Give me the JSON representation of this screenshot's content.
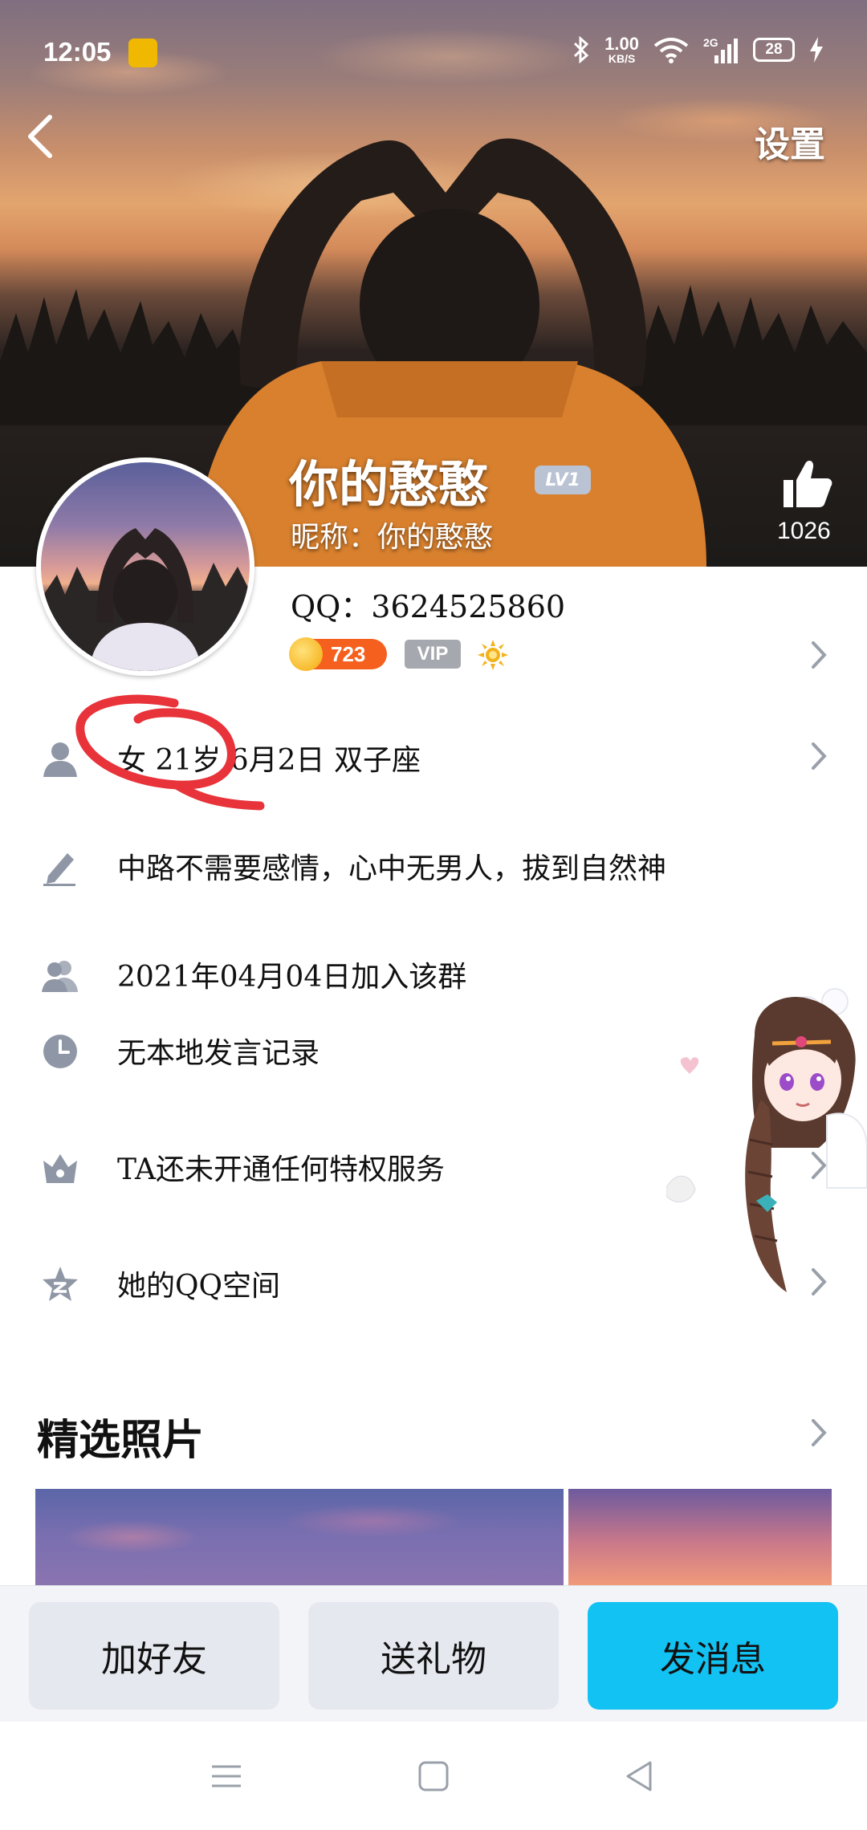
{
  "status_bar": {
    "time": "12:05",
    "speed_value": "1.00",
    "speed_unit": "KB/S",
    "network": "2G",
    "battery": "28"
  },
  "header": {
    "settings_label": "设置"
  },
  "profile": {
    "name": "你的憨憨",
    "level_badge": "LV1",
    "nickname": "昵称：你的憨憨",
    "likes": "1026",
    "qq": "QQ：3624525860",
    "coins": "723",
    "vip_label": "VIP"
  },
  "info_rows": {
    "basic": "女  21岁  6月2日  双子座",
    "signature": "中路不需要感情，心中无男人，拔到自然神",
    "joined": "2021年04月04日加入该群",
    "speech": "无本地发言记录",
    "privilege": "TA还未开通任何特权服务",
    "qzone": "她的QQ空间"
  },
  "featured": {
    "title": "精选照片"
  },
  "actions": {
    "add_friend": "加好友",
    "send_gift": "送礼物",
    "send_message": "发消息"
  },
  "colors": {
    "primary": "#12c2f2",
    "row_icon": "#8f97a6",
    "annotation": "#e8333a"
  }
}
